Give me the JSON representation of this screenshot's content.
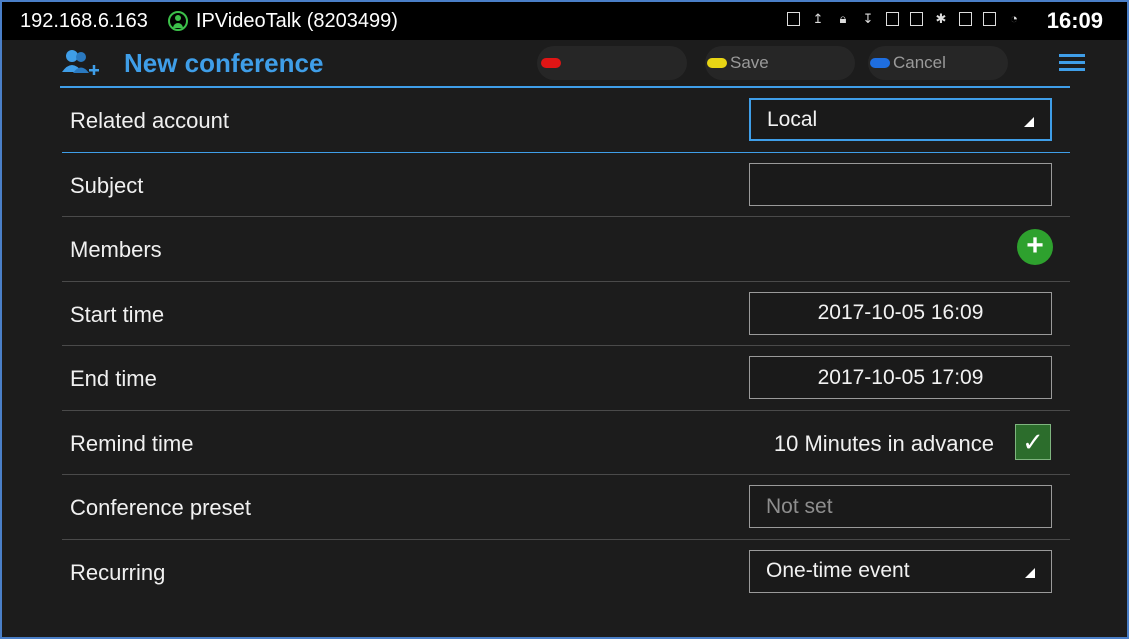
{
  "status_bar": {
    "ip": "192.168.6.163",
    "account": "IPVideoTalk (8203499)",
    "time": "16:09",
    "icons": [
      "screenshot-icon",
      "upload-icon",
      "lock-icon",
      "download-icon",
      "sim-icon",
      "network-icon",
      "bluetooth-icon",
      "storage-icon",
      "display-icon",
      "wifi-icon"
    ]
  },
  "header": {
    "title": "New conference",
    "save_label": "Save",
    "cancel_label": "Cancel",
    "colors": {
      "accent": "#3f9ee8",
      "red": "#e01515",
      "yellow": "#e8d514",
      "blue": "#1e6ee0"
    }
  },
  "form": {
    "related_account": {
      "label": "Related account",
      "value": "Local"
    },
    "subject": {
      "label": "Subject",
      "value": ""
    },
    "members": {
      "label": "Members"
    },
    "start_time": {
      "label": "Start time",
      "value": "2017-10-05 16:09"
    },
    "end_time": {
      "label": "End time",
      "value": "2017-10-05 17:09"
    },
    "remind_time": {
      "label": "Remind time",
      "value": "10 Minutes in advance",
      "checked": true
    },
    "conference_preset": {
      "label": "Conference preset",
      "placeholder": "Not set"
    },
    "recurring": {
      "label": "Recurring",
      "value": "One-time event"
    }
  }
}
